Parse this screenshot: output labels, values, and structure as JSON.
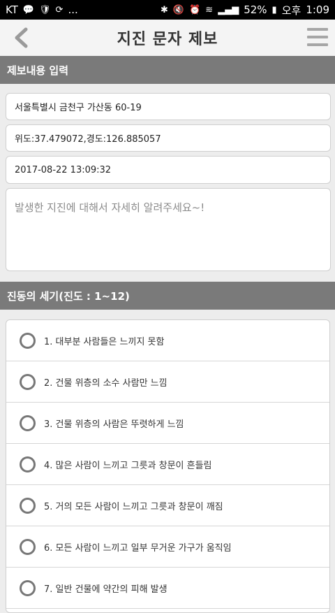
{
  "status_bar": {
    "carrier": "KT",
    "notification_dots": "...",
    "battery_percent": "52%",
    "period": "오후",
    "time": "1:09"
  },
  "header": {
    "title": "지진 문자 제보",
    "back_icon": "chevron-left-icon",
    "menu_icon": "hamburger-menu-icon"
  },
  "report_section": {
    "title": "제보내용 입력",
    "address": "서울특별시 금천구 가산동 60-19",
    "coordinates": "위도:37.479072,경도:126.885057",
    "datetime": "2017-08-22 13:09:32",
    "description_placeholder": "발생한 지진에 대해서 자세히 알려주세요~!"
  },
  "intensity_section": {
    "title": "진동의 세기(진도 : 1~12)",
    "options": [
      "1. 대부분 사람들은 느끼지 못함",
      "2. 건물 위층의 소수 사람만 느낌",
      "3. 건물 위층의 사람은 뚜렷하게 느낌",
      "4. 많은 사람이 느끼고 그릇과 창문이 흔들림",
      "5. 거의 모든 사람이 느끼고 그릇과 창문이 깨짐",
      "6. 모든 사람이 느끼고 일부 무거운 가구가 움직임",
      "7. 일반 건물에 약간의 피해 발생"
    ]
  },
  "colors": {
    "section_header_bg": "#7a7a7a",
    "app_bar_bg": "#f4f4f4",
    "page_bg": "#ededed",
    "radio_border": "#777777"
  }
}
